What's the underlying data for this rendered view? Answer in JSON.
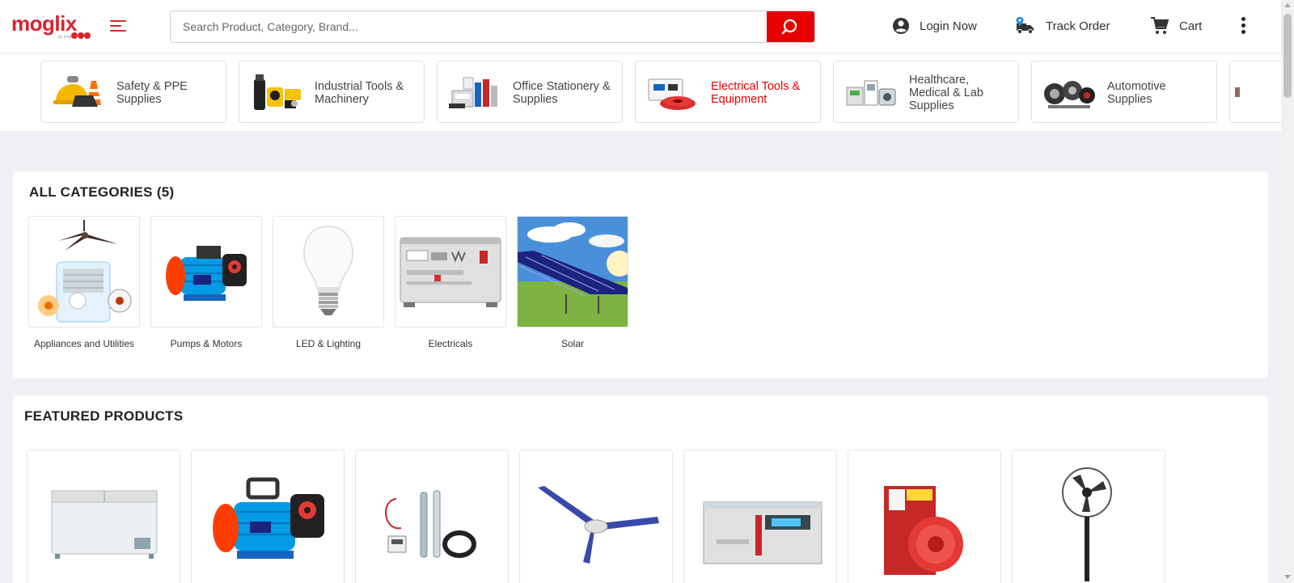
{
  "header": {
    "logo_text": "moglix",
    "logo_sub": "by moglix",
    "search_placeholder": "Search Product, Category, Brand...",
    "login_label": "Login Now",
    "track_label": "Track Order",
    "cart_label": "Cart"
  },
  "category_strip": [
    {
      "name": "Safety & PPE Supplies",
      "icon": "safety-ppe-image"
    },
    {
      "name": "Industrial Tools & Machinery",
      "icon": "industrial-tools-image"
    },
    {
      "name": "Office Stationery & Supplies",
      "icon": "office-stationery-image"
    },
    {
      "name": "Electrical Tools & Equipment",
      "icon": "electrical-tools-image",
      "active": true
    },
    {
      "name": "Healthcare, Medical & Lab Supplies",
      "icon": "healthcare-image"
    },
    {
      "name": "Automotive Supplies",
      "icon": "automotive-image"
    }
  ],
  "all_categories": {
    "title": "ALL CATEGORIES (5)",
    "items": [
      {
        "label": "Appliances and Utilities"
      },
      {
        "label": "Pumps & Motors"
      },
      {
        "label": "LED & Lighting"
      },
      {
        "label": "Electricals"
      },
      {
        "label": "Solar"
      }
    ]
  },
  "featured": {
    "title": "FEATURED PRODUCTS",
    "products": [
      {
        "image": "chest-freezer-image"
      },
      {
        "image": "water-pump-image"
      },
      {
        "image": "submersible-pump-image"
      },
      {
        "image": "ceiling-fan-image"
      },
      {
        "image": "voltage-stabilizer-image"
      },
      {
        "image": "wire-coil-image"
      },
      {
        "image": "pedestal-fan-image"
      }
    ]
  },
  "colors": {
    "brand": "#d9232d",
    "accent": "#e60000",
    "background": "#f0f0f4"
  }
}
